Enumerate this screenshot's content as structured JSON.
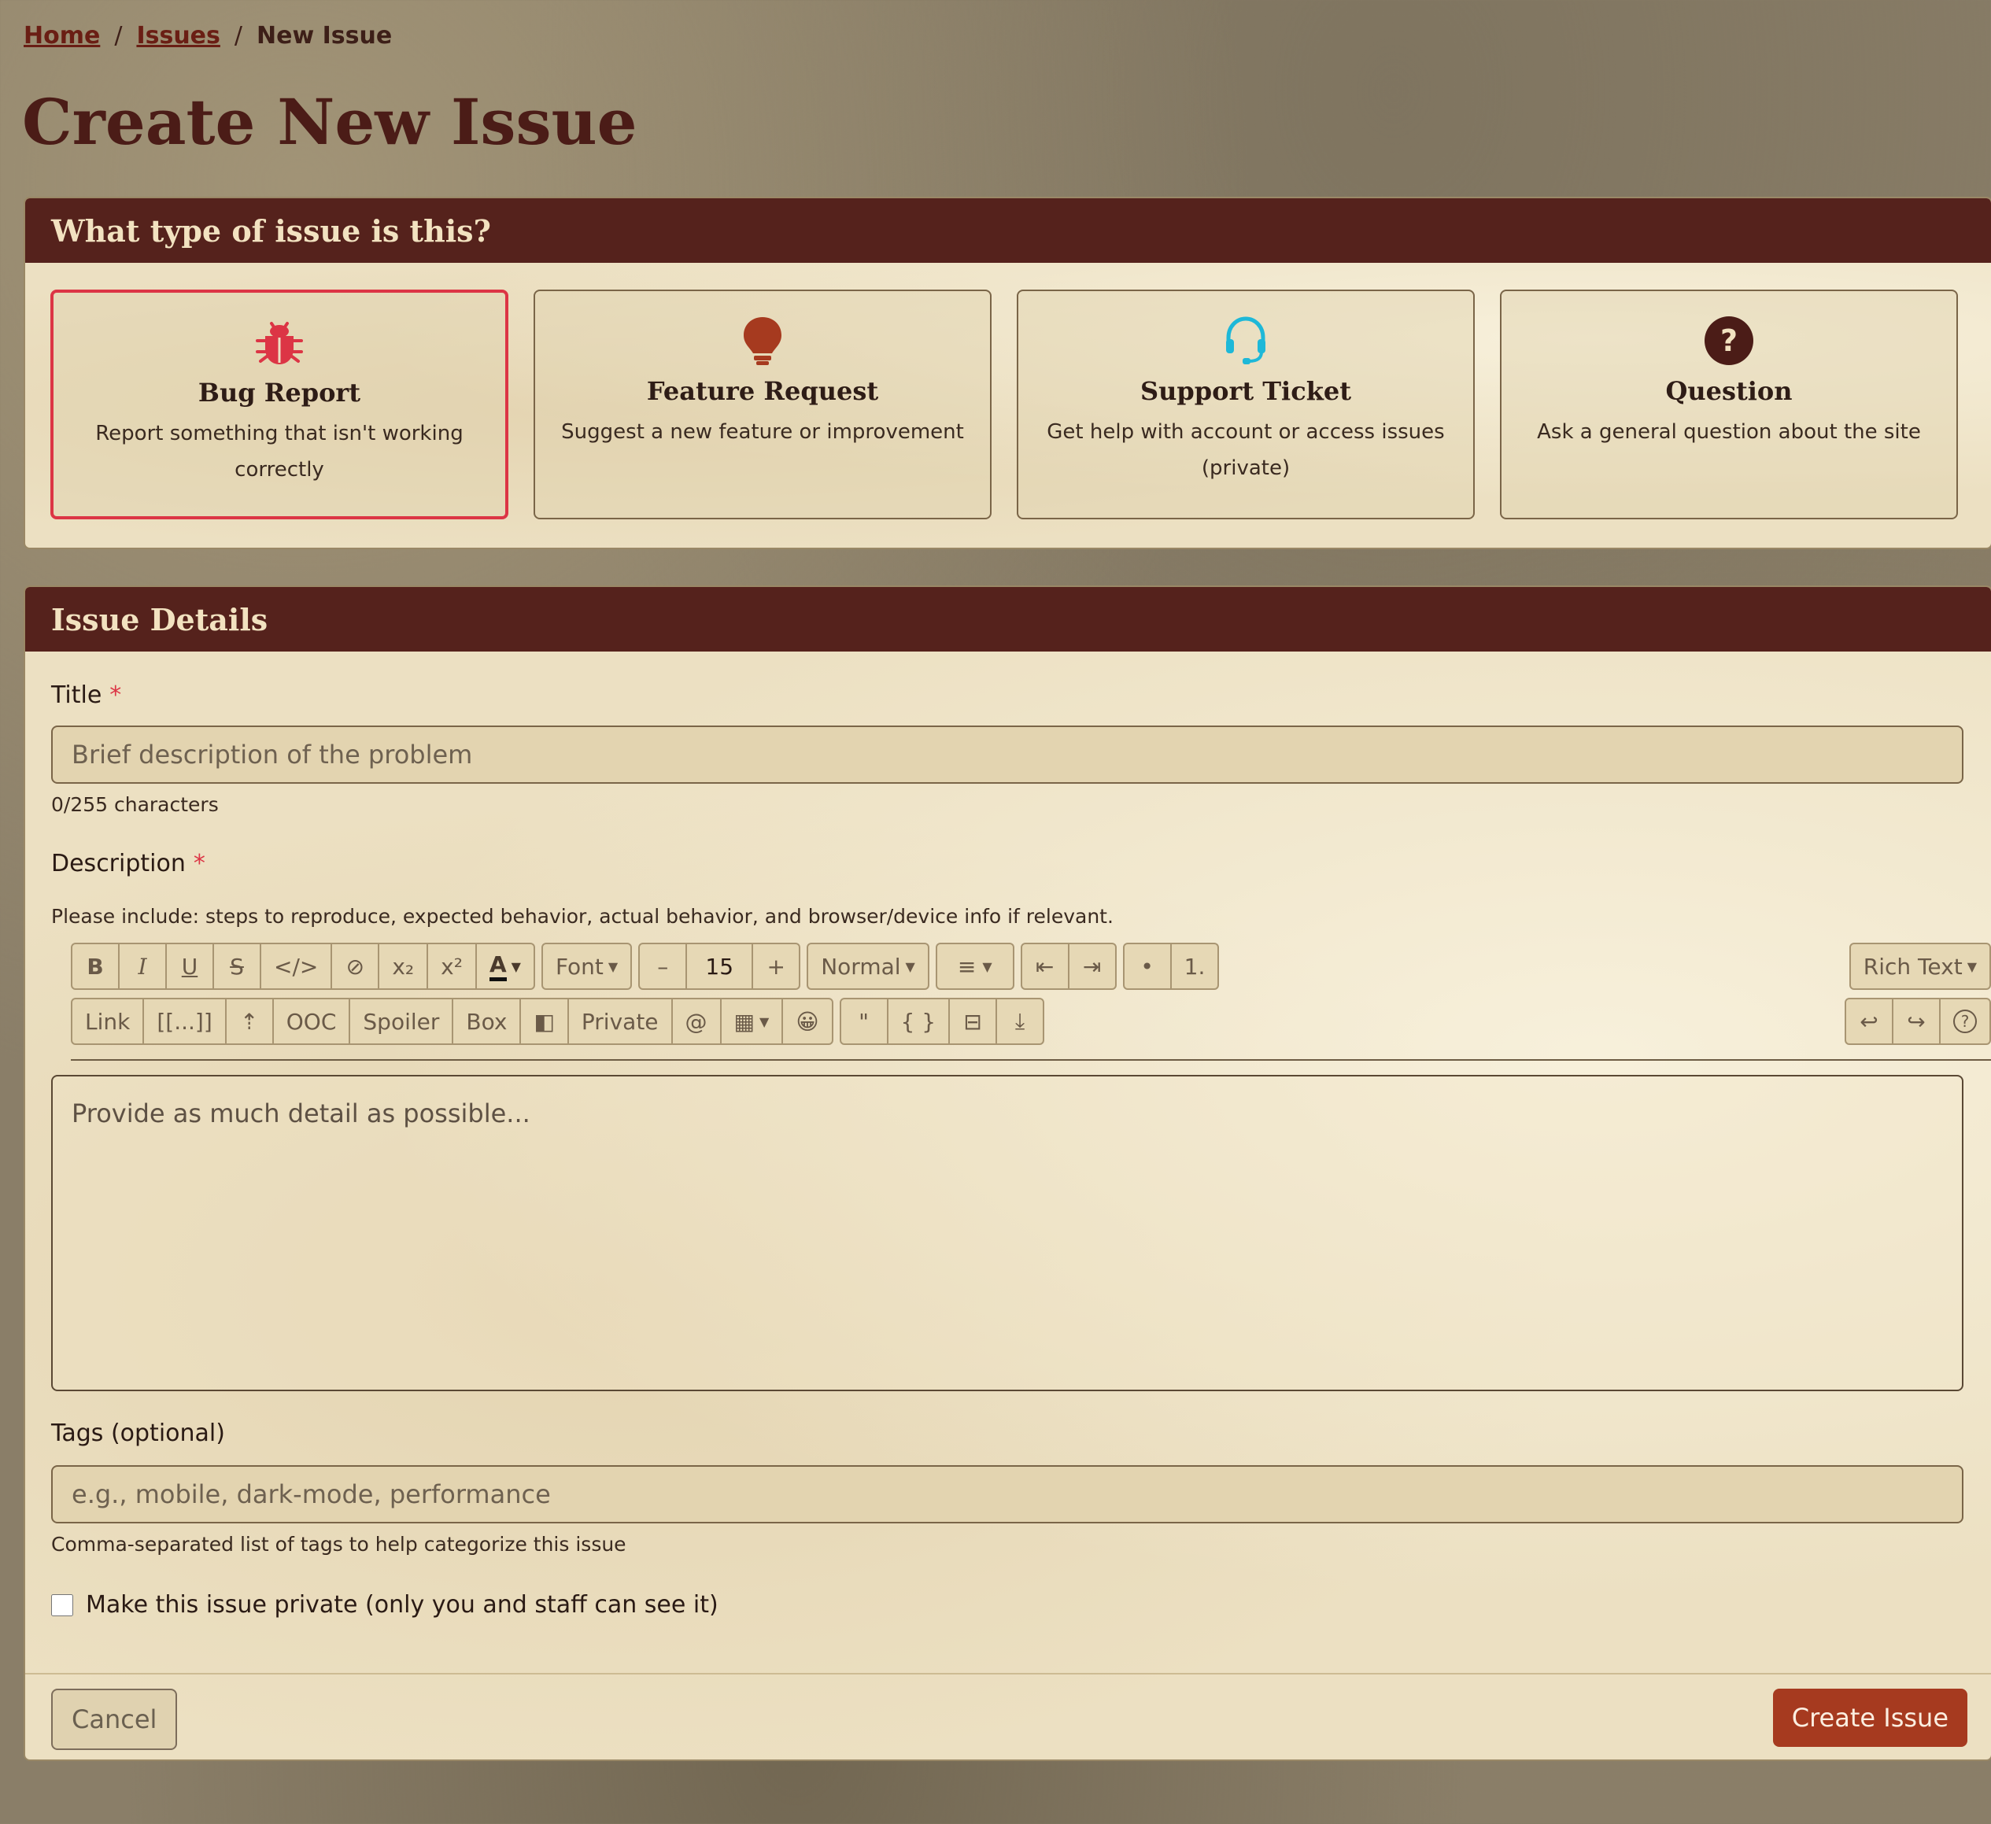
{
  "breadcrumb": {
    "home": "Home",
    "issues": "Issues",
    "current": "New Issue",
    "separator": "/"
  },
  "page": {
    "title": "Create New Issue"
  },
  "type_panel": {
    "header": "What type of issue is this?",
    "selected": "bug-report",
    "types": [
      {
        "name": "Bug Report",
        "desc": "Report something that isn't working correctly",
        "icon": "bug-icon",
        "color": "#dc3545"
      },
      {
        "name": "Feature Request",
        "desc": "Suggest a new feature or improvement",
        "icon": "lightbulb-icon",
        "color": "#a63a1f"
      },
      {
        "name": "Support Ticket",
        "desc": "Get help with account or access issues (private)",
        "icon": "headset-icon",
        "color": "#1eb8d8"
      },
      {
        "name": "Question",
        "desc": "Ask a general question about the site",
        "icon": "question-circle-icon",
        "color": "#4b1c17"
      }
    ]
  },
  "details": {
    "header": "Issue Details",
    "title_label": "Title",
    "required_mark": "*",
    "title_placeholder": "Brief description of the problem",
    "title_counter": "0/255 characters",
    "description_label": "Description",
    "description_help": "Please include: steps to reproduce, expected behavior, actual behavior, and browser/device info if relevant.",
    "editor_placeholder": "Provide as much detail as possible...",
    "tags_label": "Tags (optional)",
    "tags_placeholder": "e.g., mobile, dark-mode, performance",
    "tags_help": "Comma-separated list of tags to help categorize this issue",
    "private_label": "Make this issue private (only you and staff can see it)",
    "private_checked": false
  },
  "toolbar": {
    "bold": "B",
    "italic": "I",
    "underline": "U",
    "strike": "S",
    "code": "</>",
    "clear": "⊘",
    "subscript": "x₂",
    "superscript": "x²",
    "color": "A",
    "font": "Font",
    "minus": "–",
    "size": "15",
    "plus": "+",
    "heading": "Normal",
    "bullet": "•",
    "numbered": "1.",
    "mode": "Rich Text",
    "link": "Link",
    "wiki": "[[...]]",
    "ooc": "OOC",
    "spoiler": "Spoiler",
    "box": "Box",
    "private": "Private",
    "mention": "@",
    "quote": "\"",
    "codeblock": "{ }",
    "undo": "↩",
    "redo": "↪",
    "help": "?"
  },
  "actions": {
    "cancel": "Cancel",
    "create": "Create Issue"
  },
  "colors": {
    "header_bg": "#55221c",
    "accent": "#a63a1f",
    "danger": "#dc3545"
  }
}
